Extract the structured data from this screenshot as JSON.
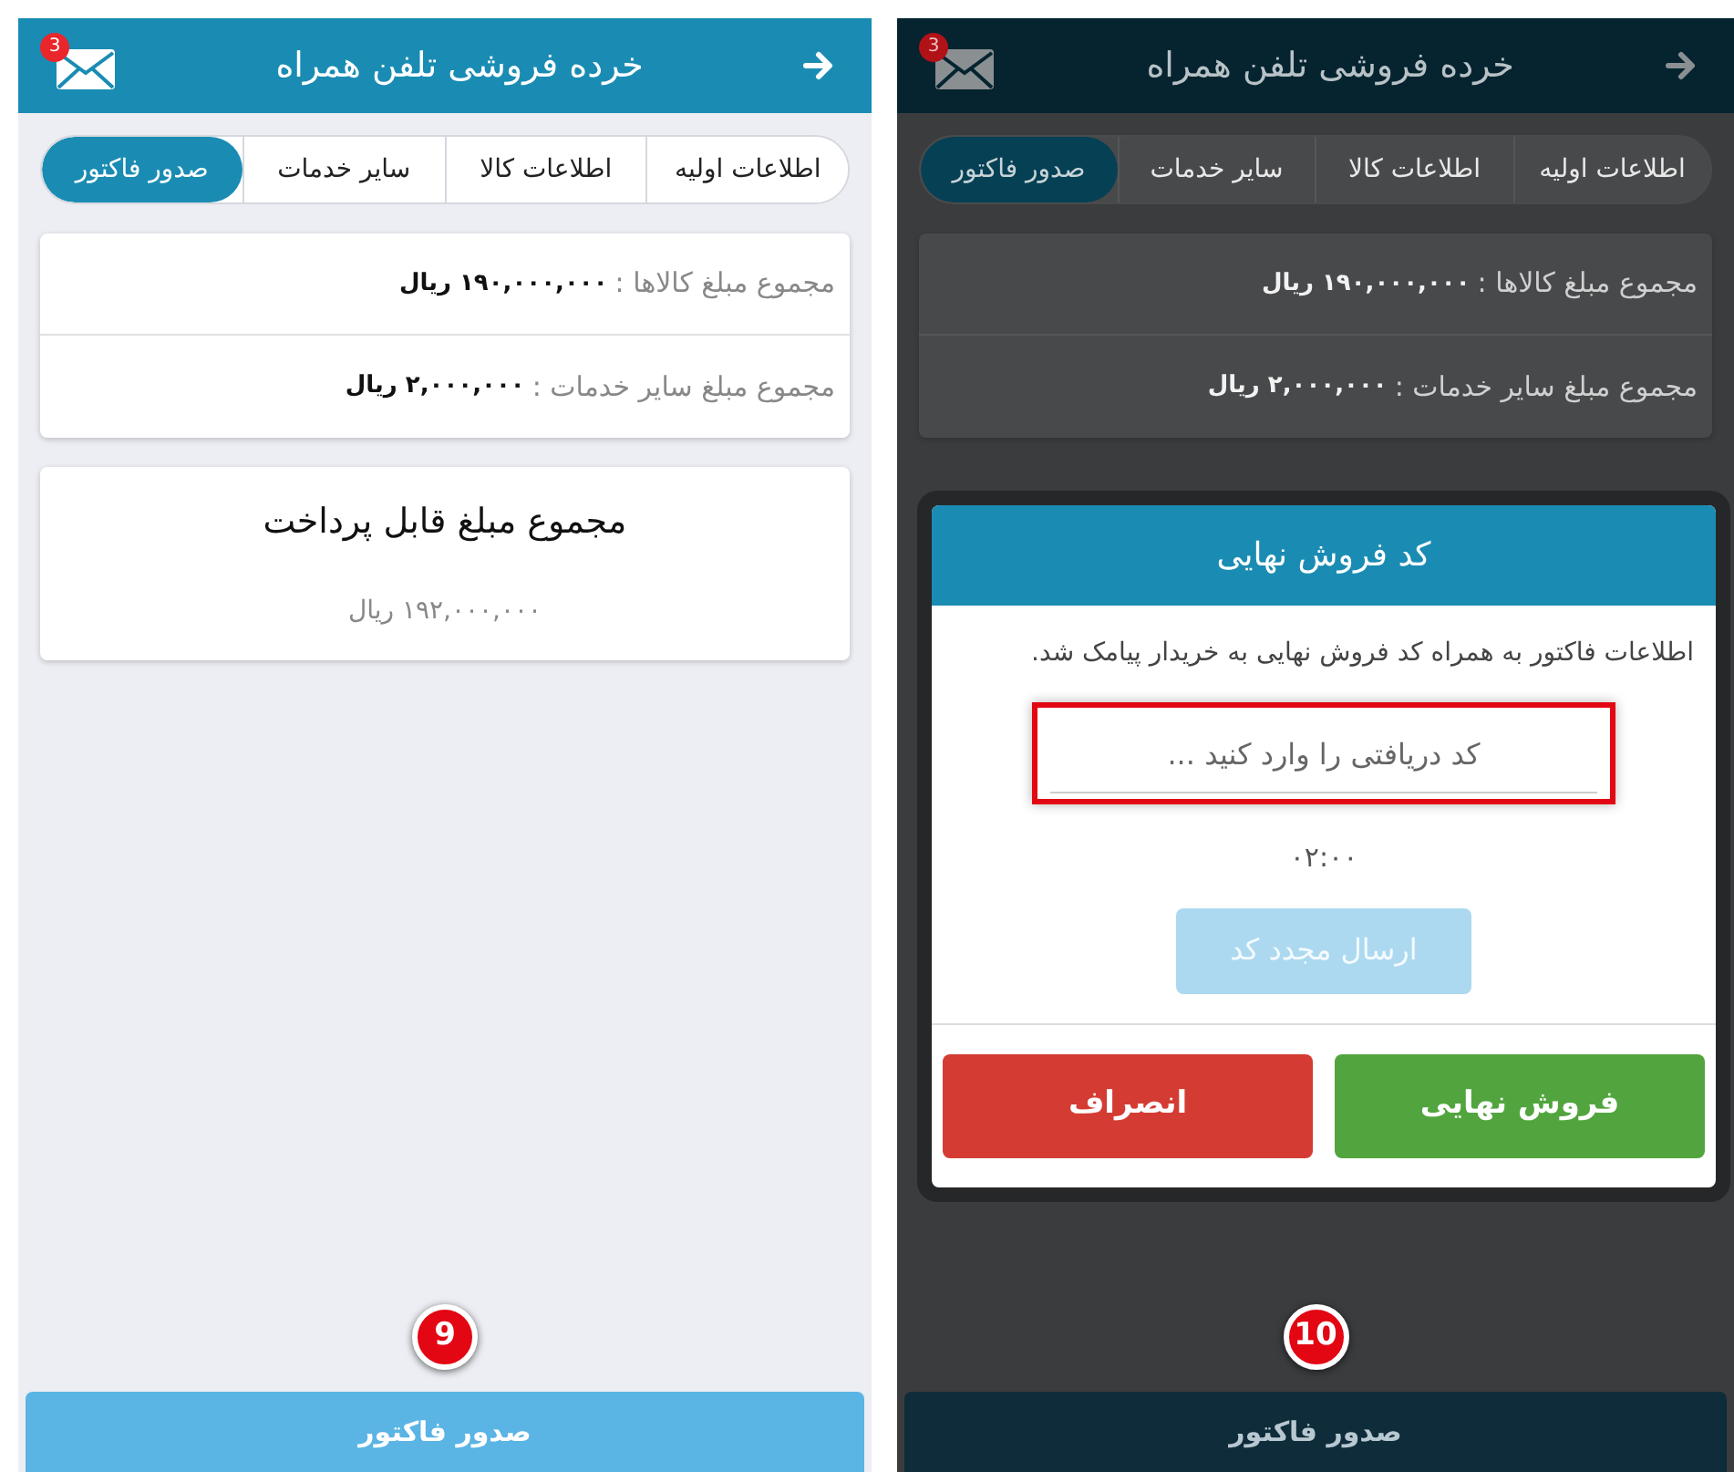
{
  "screens": [
    {
      "dimmed": true,
      "step": "10",
      "header": {
        "title": "خرده فروشی تلفن همراه",
        "mail_count": "3"
      },
      "tabs": [
        {
          "label": "اطلاعات اولیه",
          "selected": false
        },
        {
          "label": "اطلاعات کالا",
          "selected": false
        },
        {
          "label": "سایر خدمات",
          "selected": false
        },
        {
          "label": "صدور فاکتور",
          "selected": true
        }
      ],
      "summary": [
        {
          "label": "مجموع مبلغ کالاها :",
          "value": "۱۹۰,۰۰۰,۰۰۰ ریال"
        },
        {
          "label": "مجموع مبلغ سایر خدمات :",
          "value": "۲,۰۰۰,۰۰۰ ریال"
        }
      ],
      "submit_button": "صدور فاکتور",
      "dialog": {
        "title": "کد فروش نهایی",
        "message": "اطلاعات فاکتور به همراه کد فروش نهایی به خریدار پیامک شد.",
        "code_field": {
          "placeholder": "کد دریافتی را وارد کنید ...",
          "highlighted": true
        },
        "timer": "۰۲:۰۰",
        "resend_button": {
          "label": "ارسال مجدد کد",
          "disabled": true
        },
        "confirm_button": "فروش نهایی",
        "cancel_button": "انصراف"
      }
    },
    {
      "dimmed": false,
      "step": "9",
      "header": {
        "title": "خرده فروشی تلفن همراه",
        "mail_count": "3"
      },
      "tabs": [
        {
          "label": "اطلاعات اولیه",
          "selected": false
        },
        {
          "label": "اطلاعات کالا",
          "selected": false
        },
        {
          "label": "سایر خدمات",
          "selected": false
        },
        {
          "label": "صدور فاکتور",
          "selected": true
        }
      ],
      "summary": [
        {
          "label": "مجموع مبلغ کالاها :",
          "value": "۱۹۰,۰۰۰,۰۰۰ ریال"
        },
        {
          "label": "مجموع مبلغ سایر خدمات :",
          "value": "۲,۰۰۰,۰۰۰ ریال"
        }
      ],
      "total": {
        "title": "مجموع مبلغ قابل پرداخت",
        "amount": "۱۹۲,۰۰۰,۰۰۰ ریال"
      },
      "submit_button": "صدور فاکتور"
    }
  ]
}
